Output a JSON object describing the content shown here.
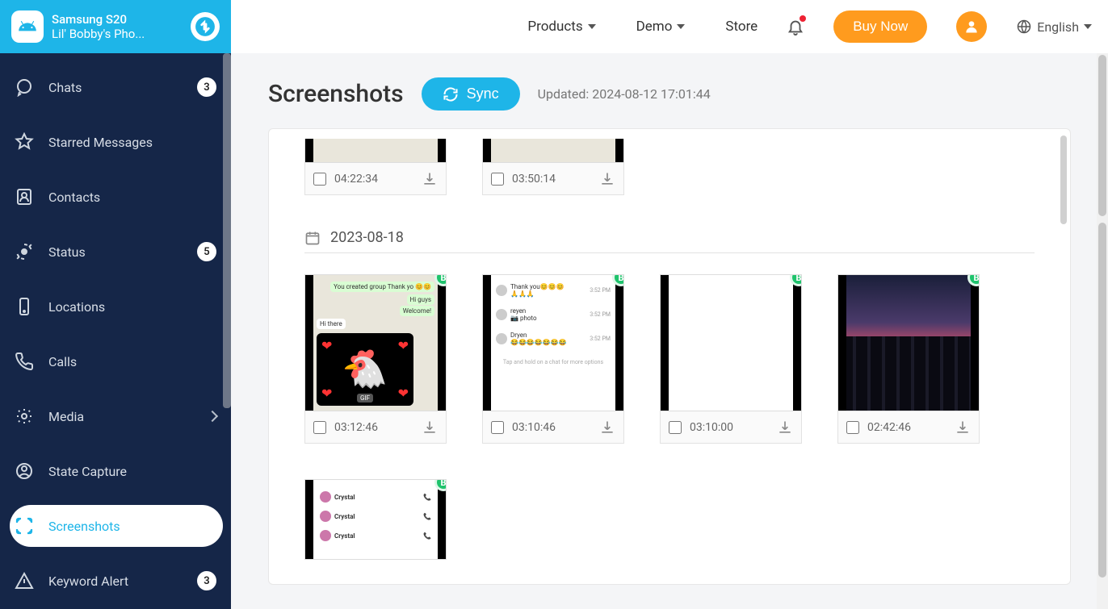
{
  "device": {
    "model": "Samsung S20",
    "name": "Lil' Bobby's Pho..."
  },
  "nav": [
    {
      "key": "chats",
      "label": "Chats",
      "badge": "3"
    },
    {
      "key": "starred",
      "label": "Starred Messages"
    },
    {
      "key": "contacts",
      "label": "Contacts"
    },
    {
      "key": "status",
      "label": "Status",
      "badge": "5"
    },
    {
      "key": "locations",
      "label": "Locations"
    },
    {
      "key": "calls",
      "label": "Calls"
    },
    {
      "key": "media",
      "label": "Media",
      "expandable": true
    },
    {
      "key": "statecapture",
      "label": "State Capture"
    },
    {
      "key": "screenshots",
      "label": "Screenshots",
      "active": true
    },
    {
      "key": "keywordalert",
      "label": "Keyword Alert",
      "badge": "3"
    }
  ],
  "topnav": {
    "products": "Products",
    "demo": "Demo",
    "store": "Store"
  },
  "actions": {
    "buy": "Buy Now",
    "language": "English"
  },
  "page": {
    "title": "Screenshots",
    "sync": "Sync",
    "updated": "Updated: 2024-08-12 17:01:44"
  },
  "group_prev_tiles": [
    {
      "time": "04:22:34"
    },
    {
      "time": "03:50:14"
    }
  ],
  "group_date": "2023-08-18",
  "group_tiles": [
    {
      "time": "03:12:46",
      "kind": "chat-sticker"
    },
    {
      "time": "03:10:46",
      "kind": "chat-white"
    },
    {
      "time": "03:10:00",
      "kind": "blank"
    },
    {
      "time": "02:42:46",
      "kind": "city"
    }
  ]
}
